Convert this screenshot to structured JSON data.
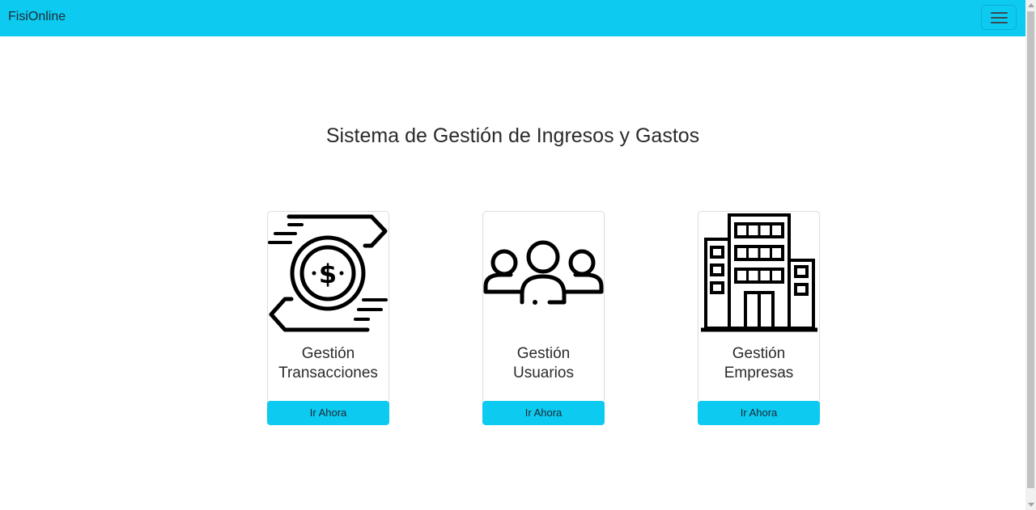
{
  "navbar": {
    "brand": "FisiOnline",
    "toggler_icon": "hamburger-menu-icon",
    "color": "#0dcaf0"
  },
  "main": {
    "title": "Sistema de Gestión de Ingresos y Gastos"
  },
  "cards": [
    {
      "icon": "money-exchange-icon",
      "title_line1": "Gestión",
      "title_line2": "Transacciones",
      "button_label": "Ir Ahora"
    },
    {
      "icon": "users-group-icon",
      "title_line1": "Gestión",
      "title_line2": "Usuarios",
      "button_label": "Ir Ahora"
    },
    {
      "icon": "building-icon",
      "title_line1": "Gestión",
      "title_line2": "Empresas",
      "button_label": "Ir Ahora"
    }
  ]
}
